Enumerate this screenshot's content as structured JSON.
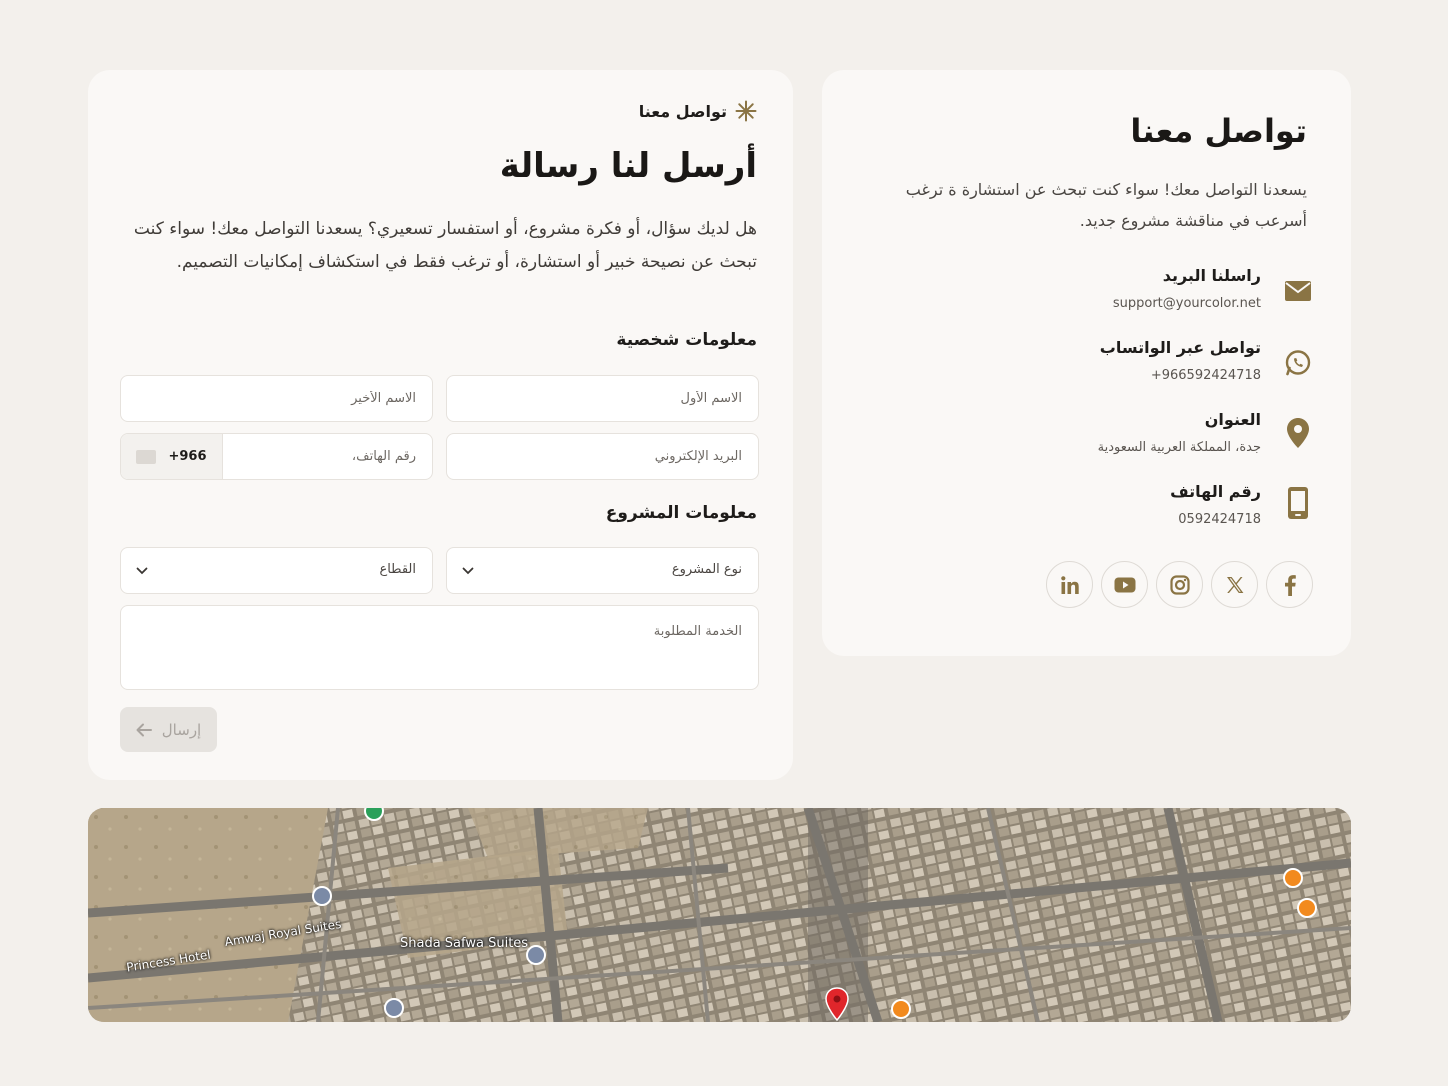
{
  "info": {
    "title": "تواصل معنا",
    "description": "يسعدنا التواصل معك! سواء كنت تبحث عن استشارة ة ترغب أسرعب في مناقشة مشروع جديد.",
    "contacts": [
      {
        "label": "راسلنا البريد",
        "value": "support@yourcolor.net",
        "icon": "envelope-icon"
      },
      {
        "label": "تواصل عبر الواتساب",
        "value": "+966592424718",
        "icon": "whatsapp-icon"
      },
      {
        "label": "العنوان",
        "value": "جدة، المملكة العربية السعودية",
        "icon": "location-pin-icon"
      },
      {
        "label": "رقم الهاتف",
        "value": "0592424718",
        "icon": "mobile-phone-icon"
      }
    ],
    "socials": [
      "facebook-icon",
      "x-icon",
      "instagram-icon",
      "youtube-icon",
      "linkedin-icon"
    ]
  },
  "form": {
    "eyebrow": "تواصل معنا",
    "title": "أرسل لنا رسالة",
    "description": "هل لديك سؤال، أو فكرة مشروع، أو استفسار تسعيري؟ يسعدنا التواصل معك! سواء كنت تبحث عن نصيحة خبير أو استشارة، أو ترغب فقط في استكشاف إمكانيات التصميم.",
    "personal_section": "معلومات شخصية",
    "first_name_placeholder": "الاسم الأول",
    "last_name_placeholder": "الاسم الأخير",
    "email_placeholder": "البريد الإلكتروني",
    "phone_placeholder": "رقم الهاتف،",
    "phone_prefix": "+966",
    "project_section": "معلومات المشروع",
    "project_type_label": "نوع المشروع",
    "sector_label": "القطاع",
    "service_placeholder": "الخدمة المطلوبة",
    "submit_label": "إرسال"
  },
  "map": {
    "labels": [
      "Shada Safwa Suites",
      "Amwaj Royal Suites",
      "Princess Hotel"
    ]
  },
  "colors": {
    "accent": "#8a7444",
    "page_bg": "#f3f0ec",
    "card_bg": "#faf8f6",
    "map_pin": "#e0262b",
    "map_poi": "#f28a1e"
  }
}
